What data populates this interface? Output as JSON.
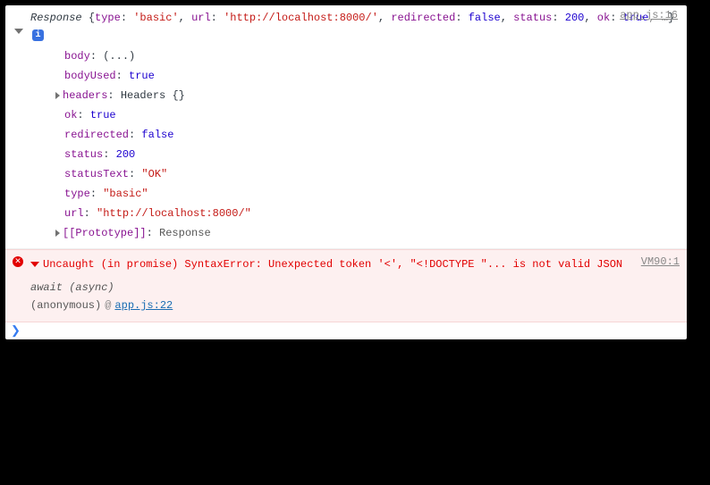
{
  "log": {
    "source": "app.js:16",
    "class_name": "Response",
    "summary": {
      "parts": [
        {
          "k": "type",
          "t": "str",
          "v": "'basic'"
        },
        {
          "k": "url",
          "t": "str",
          "v": "'http://localhost:8000/'"
        },
        {
          "k": "redirected",
          "t": "bool",
          "v": "false"
        },
        {
          "k": "status",
          "t": "num",
          "v": "200"
        },
        {
          "k": "ok",
          "t": "bool",
          "v": "true"
        }
      ],
      "ellipsis": ", …"
    },
    "info_badge": "i",
    "props": [
      {
        "key": "body",
        "type": "plain",
        "val": "(...)",
        "expandable": false
      },
      {
        "key": "bodyUsed",
        "type": "bool",
        "val": "true",
        "expandable": false
      },
      {
        "key": "headers",
        "type": "plain",
        "val": "Headers {}",
        "expandable": true
      },
      {
        "key": "ok",
        "type": "bool",
        "val": "true",
        "expandable": false
      },
      {
        "key": "redirected",
        "type": "bool",
        "val": "false",
        "expandable": false
      },
      {
        "key": "status",
        "type": "num",
        "val": "200",
        "expandable": false
      },
      {
        "key": "statusText",
        "type": "str",
        "val": "\"OK\"",
        "expandable": false
      },
      {
        "key": "type",
        "type": "str",
        "val": "\"basic\"",
        "expandable": false
      },
      {
        "key": "url",
        "type": "str",
        "val": "\"http://localhost:8000/\"",
        "expandable": false
      },
      {
        "key": "[[Prototype]]",
        "type": "gray",
        "val": "Response",
        "expandable": true
      }
    ]
  },
  "error": {
    "source": "VM90:1",
    "message": "Uncaught (in promise) SyntaxError: Unexpected token '<', \"<!DOCTYPE \"... is not valid JSON",
    "stack": [
      {
        "text": "await (async)",
        "italic": true,
        "link": null
      },
      {
        "text": "(anonymous)",
        "italic": false,
        "link": "app.js:22"
      }
    ]
  }
}
